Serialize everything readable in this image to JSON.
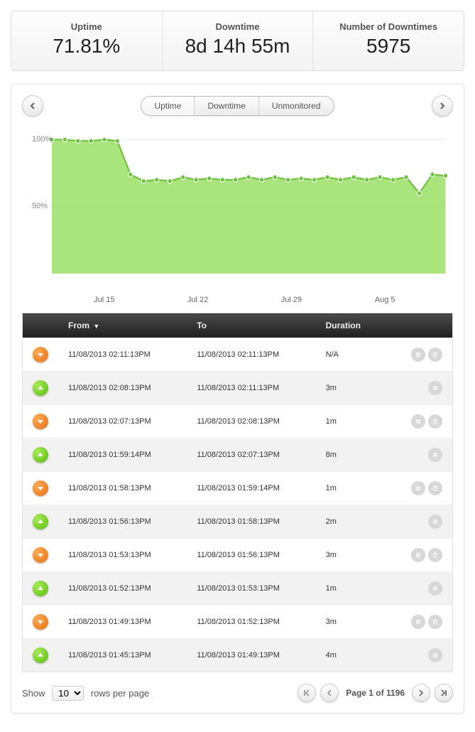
{
  "stats": {
    "uptime": {
      "label": "Uptime",
      "value": "71.81%"
    },
    "downtime": {
      "label": "Downtime",
      "value": "8d 14h 55m"
    },
    "count": {
      "label": "Number of Downtimes",
      "value": "5975"
    }
  },
  "segments": {
    "uptime": "Uptime",
    "downtime": "Downtime",
    "unmonitored": "Unmonitored",
    "active": "uptime"
  },
  "chart_data": {
    "type": "area",
    "title": "",
    "xlabel": "",
    "ylabel": "",
    "ylim": [
      0,
      105
    ],
    "x_ticks": [
      "Jul 15",
      "Jul 22",
      "Jul 29",
      "Aug 5"
    ],
    "y_ticks": [
      "50%",
      "100%"
    ],
    "categories": [
      "Jul 11",
      "Jul 12",
      "Jul 13",
      "Jul 14",
      "Jul 15",
      "Jul 16",
      "Jul 17",
      "Jul 18",
      "Jul 19",
      "Jul 20",
      "Jul 21",
      "Jul 22",
      "Jul 23",
      "Jul 24",
      "Jul 25",
      "Jul 26",
      "Jul 27",
      "Jul 28",
      "Jul 29",
      "Jul 30",
      "Jul 31",
      "Aug 1",
      "Aug 2",
      "Aug 3",
      "Aug 4",
      "Aug 5",
      "Aug 6",
      "Aug 7",
      "Aug 8",
      "Aug 9",
      "Aug 10"
    ],
    "values": [
      100,
      100,
      99,
      99,
      100,
      99,
      74,
      69,
      70,
      69,
      72,
      70,
      71,
      70,
      70,
      72,
      70,
      72,
      70,
      71,
      70,
      72,
      70,
      72,
      70,
      72,
      70,
      72,
      60,
      74,
      73
    ]
  },
  "table": {
    "headers": {
      "from": "From",
      "to": "To",
      "duration": "Duration"
    },
    "rows": [
      {
        "status": "down",
        "from": "11/08/2013 02:11:13PM",
        "to": "11/08/2013 02:11:13PM",
        "duration": "N/A",
        "actions": 2
      },
      {
        "status": "up",
        "from": "11/08/2013 02:08:13PM",
        "to": "11/08/2013 02:11:13PM",
        "duration": "3m",
        "actions": 1
      },
      {
        "status": "down",
        "from": "11/08/2013 02:07:13PM",
        "to": "11/08/2013 02:08:13PM",
        "duration": "1m",
        "actions": 2
      },
      {
        "status": "up",
        "from": "11/08/2013 01:59:14PM",
        "to": "11/08/2013 02:07:13PM",
        "duration": "8m",
        "actions": 1
      },
      {
        "status": "down",
        "from": "11/08/2013 01:58:13PM",
        "to": "11/08/2013 01:59:14PM",
        "duration": "1m",
        "actions": 2
      },
      {
        "status": "up",
        "from": "11/08/2013 01:56:13PM",
        "to": "11/08/2013 01:58:13PM",
        "duration": "2m",
        "actions": 1
      },
      {
        "status": "down",
        "from": "11/08/2013 01:53:13PM",
        "to": "11/08/2013 01:56:13PM",
        "duration": "3m",
        "actions": 2
      },
      {
        "status": "up",
        "from": "11/08/2013 01:52:13PM",
        "to": "11/08/2013 01:53:13PM",
        "duration": "1m",
        "actions": 1
      },
      {
        "status": "down",
        "from": "11/08/2013 01:49:13PM",
        "to": "11/08/2013 01:52:13PM",
        "duration": "3m",
        "actions": 2
      },
      {
        "status": "up",
        "from": "11/08/2013 01:45:13PM",
        "to": "11/08/2013 01:49:13PM",
        "duration": "4m",
        "actions": 1
      }
    ]
  },
  "pager": {
    "show_label": "Show",
    "rows_label": "rows per page",
    "per_page": "10",
    "page_info": "Page 1 of 1196"
  }
}
